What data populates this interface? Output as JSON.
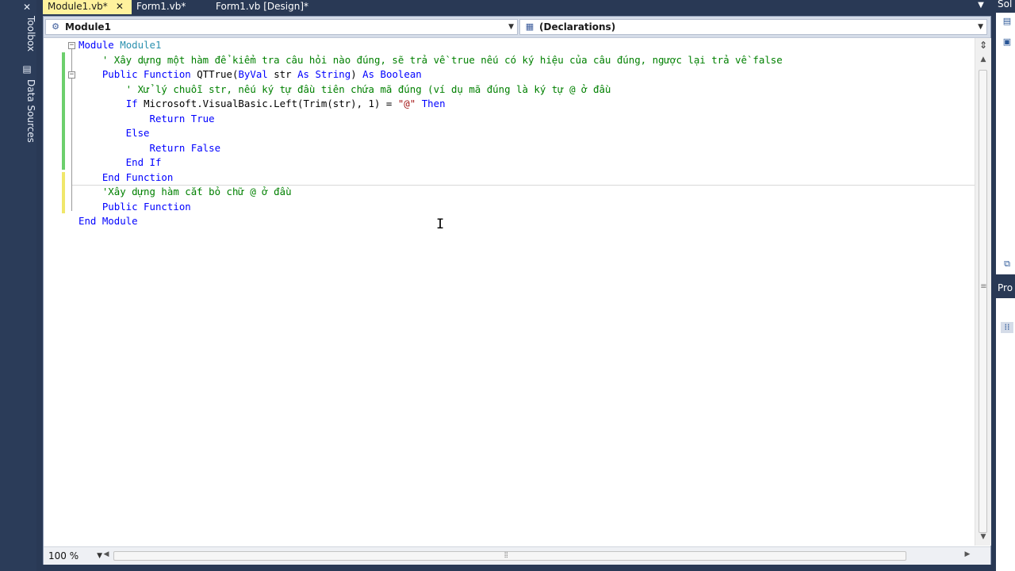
{
  "left_strip": {
    "toolbox_label": "Toolbox",
    "datasources_label": "Data Sources"
  },
  "tabs": [
    {
      "label": "Module1.vb*",
      "active": true
    },
    {
      "label": "Form1.vb*",
      "active": false
    },
    {
      "label": "Form1.vb [Design]*",
      "active": false
    }
  ],
  "navbar": {
    "left_combo": "Module1",
    "right_combo": "(Declarations)"
  },
  "code_lines": [
    "Module Module1",
    "    ' Xây dựng một hàm để kiểm tra câu hỏi nào đúng, sẽ trả về true nếu có ký hiệu của câu đúng, ngược lại trả về false",
    "    Public Function QTTrue(ByVal str As String) As Boolean",
    "        ' Xử lý chuỗi str, nếu ký tự đầu tiên chứa mã đúng (ví dụ mã đúng là ký tự @ ở đầu",
    "        If Microsoft.VisualBasic.Left(Trim(str), 1) = \"@\" Then",
    "            Return True",
    "        Else",
    "            Return False",
    "        End If",
    "    End Function",
    "    'Xây dựng hàm cắt bỏ chữ @ ở đầu",
    "    Public Function",
    "End Module"
  ],
  "zoom": "100 %",
  "right_panel": {
    "solution_label": "Sol",
    "properties_label": "Pro"
  },
  "colors": {
    "keyword": "#0000ff",
    "comment": "#008000",
    "string": "#a31515",
    "active_tab": "#fff29d",
    "chrome": "#293955"
  }
}
